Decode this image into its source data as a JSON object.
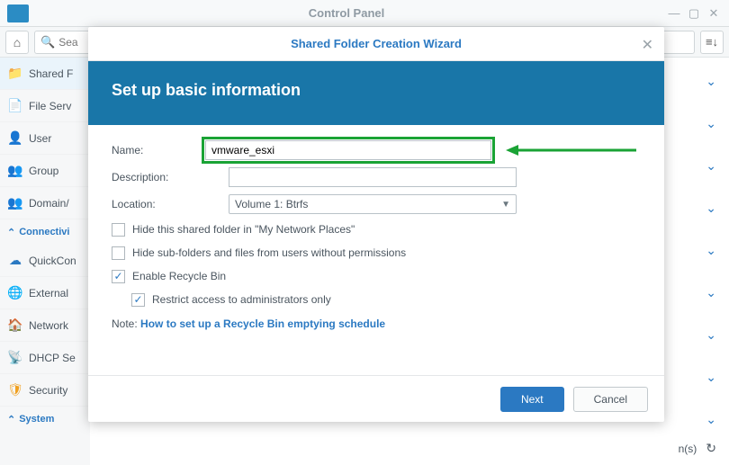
{
  "window": {
    "title": "Control Panel"
  },
  "toolbar": {
    "search_placeholder": "Sea"
  },
  "sidebar": {
    "items": [
      {
        "label": "Shared F"
      },
      {
        "label": "File Serv"
      },
      {
        "label": "User"
      },
      {
        "label": "Group"
      },
      {
        "label": "Domain/"
      },
      {
        "label": "Connectivi"
      },
      {
        "label": "QuickCon"
      },
      {
        "label": "External"
      },
      {
        "label": "Network"
      },
      {
        "label": "DHCP Se"
      },
      {
        "label": "Security"
      },
      {
        "label": "System"
      }
    ]
  },
  "modal": {
    "title": "Shared Folder Creation Wizard",
    "heading": "Set up basic information",
    "fields": {
      "name_label": "Name:",
      "name_value": "vmware_esxi",
      "desc_label": "Description:",
      "desc_value": "",
      "location_label": "Location:",
      "location_value": "Volume 1:  Btrfs"
    },
    "checks": {
      "hide_network": "Hide this shared folder in \"My Network Places\"",
      "hide_sub": "Hide sub-folders and files from users without permissions",
      "recycle": "Enable Recycle Bin",
      "restrict": "Restrict access to administrators only"
    },
    "note": {
      "prefix": "Note:",
      "link": "How to set up a Recycle Bin emptying schedule"
    },
    "buttons": {
      "next": "Next",
      "cancel": "Cancel"
    }
  },
  "footer": {
    "text": "n(s)"
  }
}
